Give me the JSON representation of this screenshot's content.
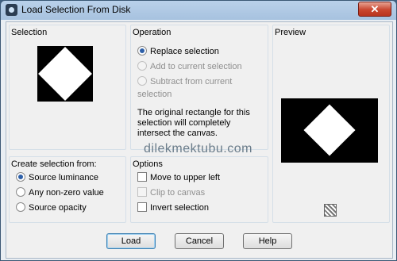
{
  "window": {
    "title": "Load Selection From Disk",
    "close_glyph": "✕"
  },
  "selection": {
    "label": "Selection"
  },
  "operation": {
    "label": "Operation",
    "options": [
      {
        "label": "Replace selection",
        "checked": true,
        "enabled": true
      },
      {
        "label": "Add to current selection",
        "checked": false,
        "enabled": false
      },
      {
        "label": "Subtract from current selection",
        "checked": false,
        "enabled": false
      }
    ],
    "info_text": "The original rectangle for this selection will completely intersect the canvas."
  },
  "preview": {
    "label": "Preview"
  },
  "create": {
    "label": "Create selection from:",
    "options": [
      {
        "label": "Source luminance",
        "checked": true
      },
      {
        "label": "Any non-zero value",
        "checked": false
      },
      {
        "label": "Source opacity",
        "checked": false
      }
    ]
  },
  "options": {
    "label": "Options",
    "items": [
      {
        "label": "Move to upper left",
        "checked": false,
        "enabled": true
      },
      {
        "label": "Clip to canvas",
        "checked": false,
        "enabled": false
      },
      {
        "label": "Invert selection",
        "checked": false,
        "enabled": true
      }
    ]
  },
  "watermark": "dilekmektubu.com",
  "buttons": {
    "load": "Load",
    "cancel": "Cancel",
    "help": "Help"
  },
  "icons": {
    "app": "app-icon",
    "preview_pattern": "pattern-icon"
  }
}
